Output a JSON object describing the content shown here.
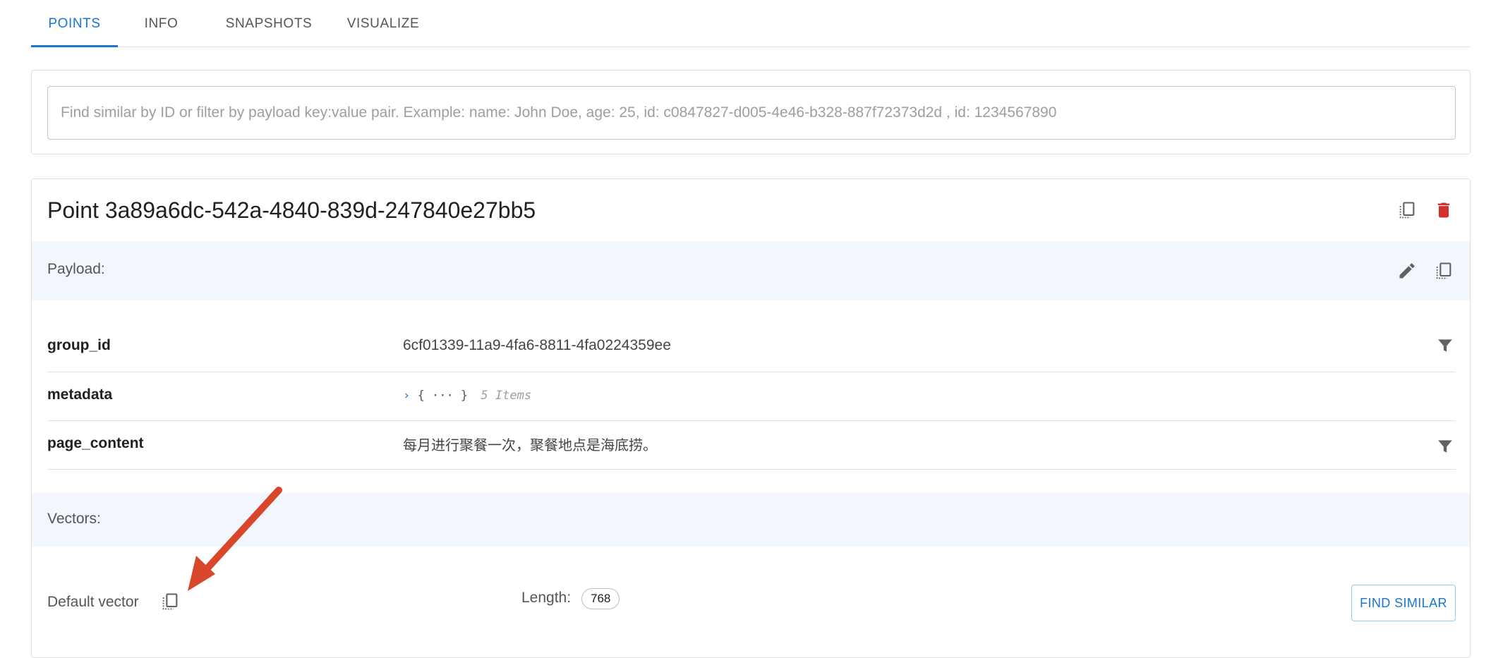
{
  "tabs": [
    {
      "label": "POINTS",
      "active": true
    },
    {
      "label": "INFO",
      "active": false
    },
    {
      "label": "SNAPSHOTS",
      "active": false
    },
    {
      "label": "VISUALIZE",
      "active": false
    }
  ],
  "search": {
    "placeholder": "Find similar by ID or filter by payload key:value pair. Example: name: John Doe, age: 25, id: c0847827-d005-4e46-b328-887f72373d2d , id: 1234567890",
    "value": ""
  },
  "point": {
    "title": "Point 3a89a6dc-542a-4840-839d-247840e27bb5",
    "header_icons": [
      "copy-icon",
      "trash-icon"
    ],
    "payload_label": "Payload:",
    "payload_icons": [
      "pencil-icon",
      "copy-icon"
    ],
    "payload": [
      {
        "key": "group_id",
        "value": "6cf01339-11a9-4fa6-8811-4fa0224359ee",
        "filter_icon": true
      },
      {
        "key": "metadata",
        "collapsed": "{ ··· }",
        "count": "5 Items",
        "filter_icon": false
      },
      {
        "key": "page_content",
        "value": "每月进行聚餐一次，聚餐地点是海底捞。",
        "filter_icon": true
      }
    ],
    "vectors_label": "Vectors:",
    "vector": {
      "name": "Default vector",
      "length_label": "Length:",
      "length": "768",
      "find_similar": "FIND SIMILAR"
    }
  },
  "colors": {
    "accent": "#1976d2",
    "delete": "#d32f2f",
    "band": "#f1f7fd",
    "annotation_arrow": "#d9472b"
  }
}
